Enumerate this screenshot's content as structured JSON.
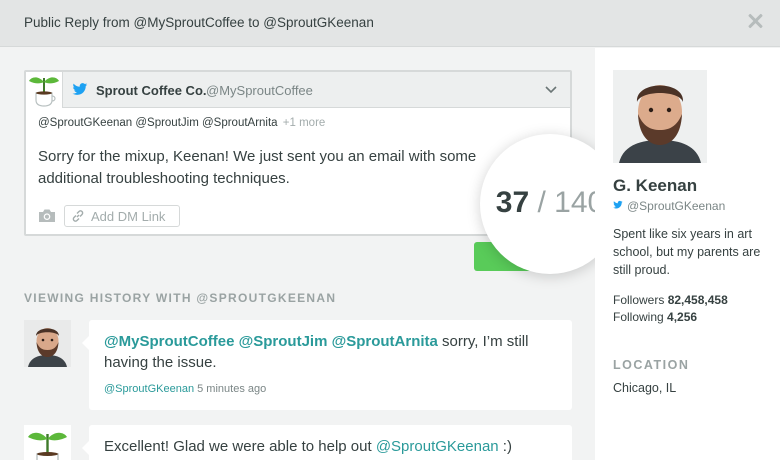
{
  "header": {
    "title": "Public Reply from @MySproutCoffee to @SproutGKeenan"
  },
  "composer": {
    "account_name": "Sprout Coffee Co.",
    "account_handle": "@MySproutCoffee",
    "recipients": "@SproutGKeenan @SproutJim @SproutArnita",
    "recipients_more": "+1 more",
    "message": "Sorry for the mixup, Keenan! We just sent you an email with some additional troubleshooting techniques.",
    "dm_link_label": "Add DM Link",
    "char_count": "37",
    "char_separator": "/",
    "char_max": "140"
  },
  "history": {
    "heading": "VIEWING HISTORY WITH @SPROUTGKEENAN",
    "messages": [
      {
        "mentions": "@MySproutCoffee @SproutJim @SproutArnita",
        "text": " sorry, I’m still having the issue.",
        "author": "@SproutGKeenan",
        "time": "5 minutes ago"
      },
      {
        "text_before": "Excellent! Glad we were able to help out ",
        "mention": "@SproutGKeenan",
        "text_after": " :)"
      }
    ]
  },
  "profile": {
    "name": "G. Keenan",
    "handle": "@SproutGKeenan",
    "bio": "Spent like six years in art school, but my parents are still proud.",
    "followers_label": "Followers",
    "followers_value": "82,458,458",
    "following_label": "Following",
    "following_value": "4,256",
    "location_heading": "LOCATION",
    "location_value": "Chicago, IL"
  },
  "colors": {
    "accent_teal": "#2a9a9a",
    "send_green": "#59cb59",
    "twitter_blue": "#1da1f2"
  },
  "icons": [
    "close-icon",
    "twitter-icon",
    "chevron-down-icon",
    "camera-icon",
    "link-icon"
  ]
}
